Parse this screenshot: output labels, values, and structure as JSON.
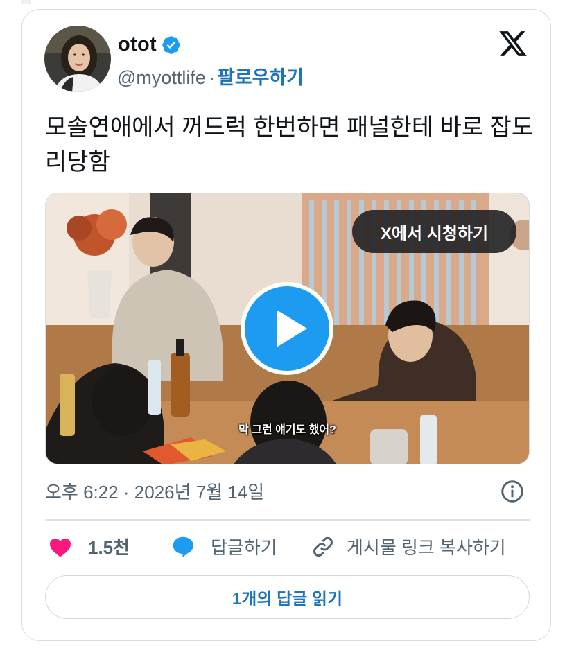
{
  "author": {
    "display_name": "otot",
    "handle": "@myottlife",
    "separator": "·",
    "follow_label": "팔로우하기",
    "verified": true
  },
  "tweet": {
    "text": "모솔연애에서 꺼드럭 한번하면 패널한테 바로 잡도리당함"
  },
  "media": {
    "watch_label": "X에서 시청하기",
    "subtitle": "막 그런 얘기도 했어?"
  },
  "meta": {
    "timestamp": "오후 6:22 · 2026년 7월 14일"
  },
  "actions": {
    "like_count": "1.5천",
    "reply_label": "답글하기",
    "copy_link_label": "게시물 링크 복사하기"
  },
  "replies": {
    "read_label": "1개의 답글 읽기"
  },
  "colors": {
    "accent_blue": "#1d9bf0",
    "link_blue": "#1d74b8",
    "like_pink": "#f91880",
    "text_primary": "#0f1419",
    "text_secondary": "#536471"
  },
  "icons": {
    "platform": "x-logo-icon",
    "verified": "verified-badge-icon",
    "play": "play-icon",
    "info": "info-icon",
    "like": "heart-icon",
    "reply": "speech-bubble-icon",
    "copy": "link-icon"
  }
}
